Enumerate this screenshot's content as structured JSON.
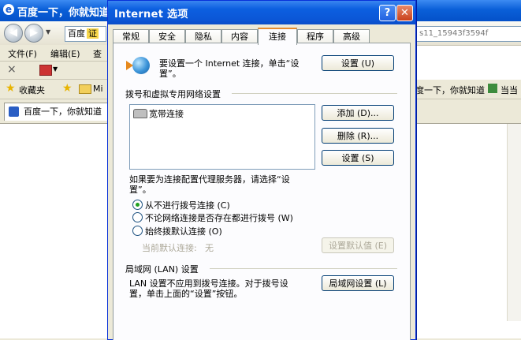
{
  "browser": {
    "title": "百度一下，你就知道",
    "logo_glyph": "e",
    "back_glyph": "◀",
    "forward_glyph": "▶",
    "address_prefix": "百度",
    "address_tag": "证",
    "address_url": "s11_15943f3594f",
    "menu": {
      "file": "文件(F)",
      "edit": "编辑(E)",
      "view": "查看"
    },
    "toolbar_close": "×",
    "favorites": {
      "label": "收藏夹",
      "folder": "Mi",
      "item_right": "度一下，你就知道",
      "item_right2": "当当"
    },
    "tab_title": "百度一下，你就知道"
  },
  "dialog": {
    "title": "Internet 选项",
    "help_glyph": "?",
    "close_glyph": "✕",
    "tabs": [
      {
        "label": "常规",
        "active": false
      },
      {
        "label": "安全",
        "active": false
      },
      {
        "label": "隐私",
        "active": false
      },
      {
        "label": "内容",
        "active": false
      },
      {
        "label": "连接",
        "active": true
      },
      {
        "label": "程序",
        "active": false
      },
      {
        "label": "高级",
        "active": false
      }
    ],
    "setup_line1": "要设置一个 Internet 连接，单击“设",
    "setup_line2": "置”。",
    "setup_button": "设置 (U)",
    "dialup_section": "拨号和虚拟专用网络设置",
    "dialup_items": [
      "宽带连接"
    ],
    "add_button": "添加 (D)...",
    "remove_button": "删除 (R)...",
    "settings_button": "设置 (S)",
    "proxy_line1": "如果要为连接配置代理服务器，请选择“设",
    "proxy_line2": "置”。",
    "radios": [
      {
        "label": "从不进行拨号连接 (C)",
        "checked": true
      },
      {
        "label": "不论网络连接是否存在都进行拨号 (W)",
        "checked": false
      },
      {
        "label": "始终拨默认连接 (O)",
        "checked": false
      }
    ],
    "current_default_label": "当前默认连接:",
    "current_default_value": "无",
    "set_default_button": "设置默认值 (E)",
    "lan_section": "局域网 (LAN) 设置",
    "lan_line1": "LAN 设置不应用到拨号连接。对于拨号设",
    "lan_line2": "置，单击上面的“设置”按钮。",
    "lan_button": "局域网设置 (L)"
  }
}
